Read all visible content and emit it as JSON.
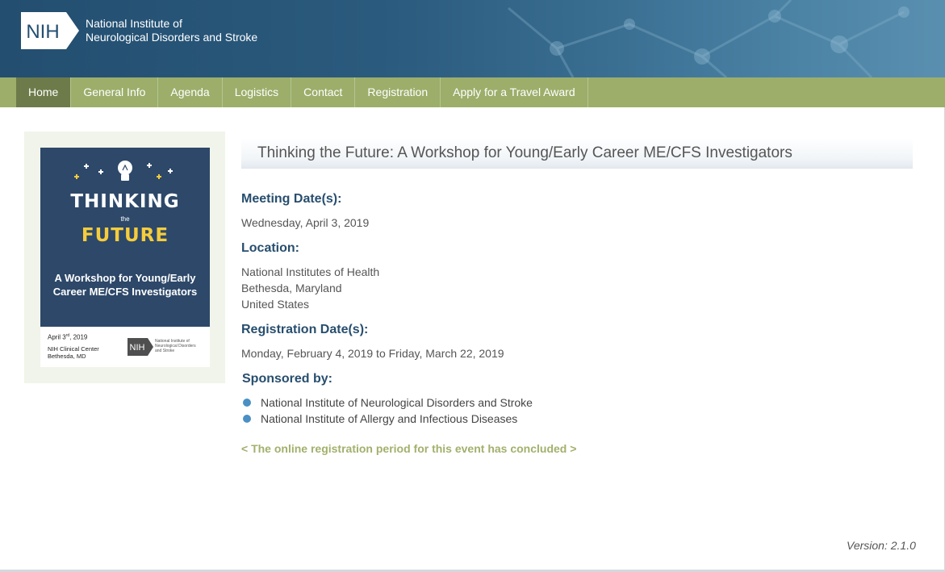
{
  "header": {
    "logo_text": "NIH",
    "org_line1": "National Institute of",
    "org_line2": "Neurological Disorders and Stroke"
  },
  "nav": {
    "items": [
      "Home",
      "General Info",
      "Agenda",
      "Logistics",
      "Contact",
      "Registration",
      "Apply for a Travel Award"
    ],
    "active": "Home"
  },
  "poster": {
    "title1": "THINKING",
    "the": "the",
    "title2": "FUTURE",
    "subtitle_line1": "A Workshop for Young/Early",
    "subtitle_line2": "Career ME/CFS Investigators",
    "date_prefix": "April 3",
    "date_sup": "rd",
    "date_suffix": ", 2019",
    "venue_line1": "NIH Clinical Center",
    "venue_line2": "Bethesda, MD",
    "nih_logo": "NIH",
    "nih_line1": "National Institute of",
    "nih_line2": "Neurological Disorders",
    "nih_line3": "and Stroke"
  },
  "main": {
    "title": "Thinking the Future: A Workshop for Young/Early Career ME/CFS Investigators",
    "meeting_label": "Meeting Date(s):",
    "meeting_value": "Wednesday, April 3, 2019",
    "location_label": "Location:",
    "location_lines": [
      "National Institutes of Health",
      "Bethesda, Maryland",
      "United States"
    ],
    "registration_label": "Registration Date(s):",
    "registration_value": "Monday, February 4, 2019 to Friday, March 22, 2019",
    "sponsored_label": "Sponsored by:",
    "sponsors": [
      "National Institute of Neurological Disorders and Stroke",
      "National Institute of Allergy and Infectious Diseases"
    ],
    "concluded": "< The online registration period for this event has concluded >"
  },
  "footer": {
    "version": "Version: 2.1.0"
  },
  "colors": {
    "banner": "#234e70",
    "nav": "#9cae6a",
    "nav_active": "#6d7b4a",
    "label": "#274e6e",
    "bullet": "#4a90c4",
    "concluded": "#a2b06c",
    "poster_bg": "#2d4869",
    "poster_accent": "#f5cc3c"
  }
}
